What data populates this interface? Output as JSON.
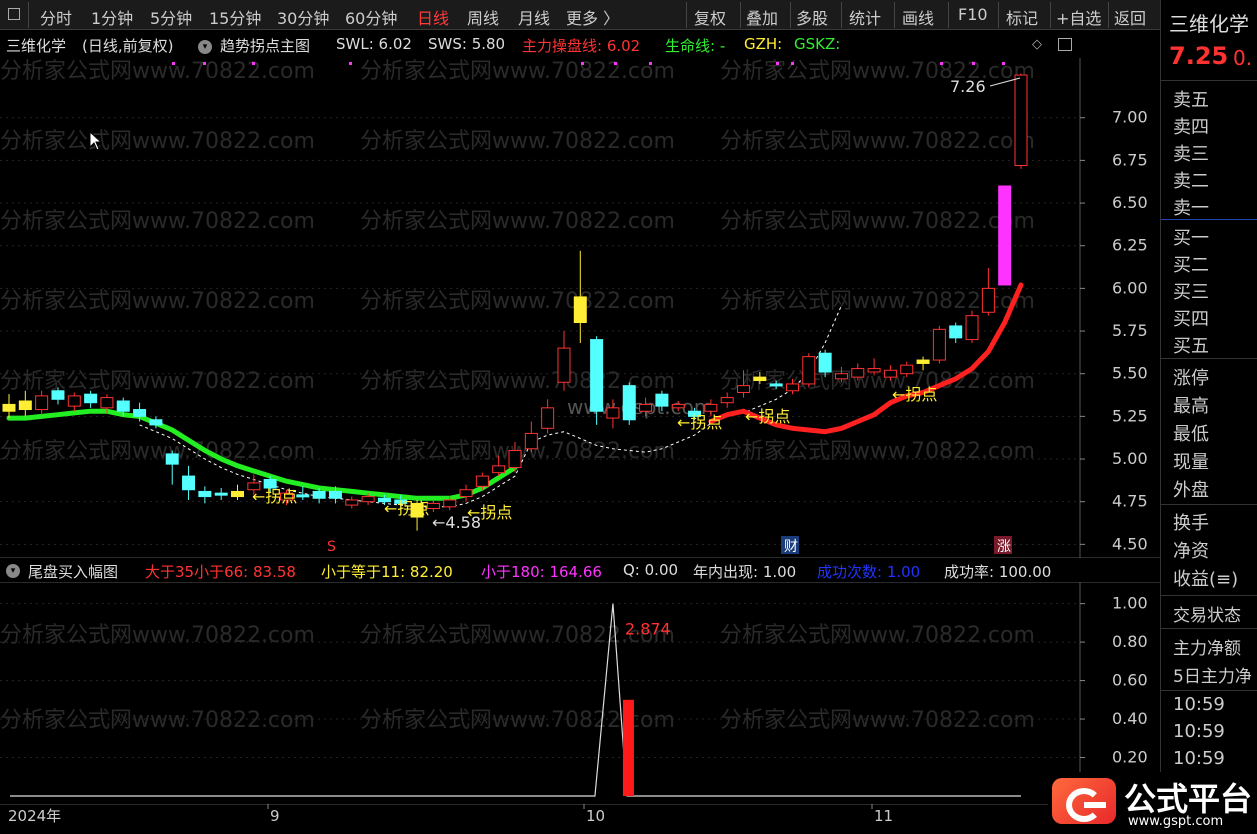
{
  "toolbar": {
    "tabs": [
      "分时",
      "1分钟",
      "5分钟",
      "15分钟",
      "30分钟",
      "60分钟",
      "日线",
      "周线",
      "月线",
      "更多 〉"
    ],
    "active_tab": "日线",
    "actions": [
      "复权",
      "叠加",
      "多股",
      "统计",
      "画线",
      "F10",
      "标记",
      "+自选",
      "返回"
    ]
  },
  "main_chart": {
    "stock_name": "三维化学",
    "period_label": "(日线,前复权)",
    "indicator_name": "趋势拐点主图",
    "swl": "SWL: 6.02",
    "sws": "SWS: 5.80",
    "main_control": "主力操盘线: 6.02",
    "life_line": "生命线: -",
    "gzh": "GZH:",
    "gskz": "GSKZ:",
    "high_label": "7.26",
    "low_label": "4.58",
    "turn_point_label": "←拐点",
    "watermark_url": "www.gspt.com",
    "watermark": "分析家公式网www.70822.com",
    "event_s": "S",
    "event_cai": "财",
    "event_zhang": "涨"
  },
  "sub_chart": {
    "indicator_name": "尾盘买入幅图",
    "gt35lt66": "大于35小于66: 83.58",
    "le11": "小于等于11: 82.20",
    "lt180": "小于180: 164.66",
    "q": "Q: 0.00",
    "year_count": "年内出现: 1.00",
    "success_count": "成功次数: 1.00",
    "success_rate": "成功率: 100.00",
    "peak_label": "2.874"
  },
  "x_axis": {
    "labels": [
      "2024年",
      "9",
      "10",
      "11"
    ]
  },
  "right_panel": {
    "stock_name": "三维化学",
    "price": "7.25",
    "price_suffix": "0.",
    "sell_levels": [
      "卖五",
      "卖四",
      "卖三",
      "卖二",
      "卖一"
    ],
    "buy_levels": [
      "买一",
      "买二",
      "买三",
      "买四",
      "买五"
    ],
    "stats": [
      "涨停",
      "最高",
      "最低",
      "现量",
      "外盘"
    ],
    "extra": [
      "换手",
      "净资",
      "收益(≡)"
    ],
    "trade_status": "交易状态",
    "main_net": "主力净额",
    "five_day": "5日主力净",
    "times": [
      "10:59",
      "10:59",
      "10:59"
    ]
  },
  "logo": {
    "text": "公式平台",
    "url": "www.gspt.com"
  },
  "colors": {
    "up": "#ff3232",
    "down": "#54ffff",
    "yellow": "#ffee33",
    "magenta": "#ff33ff",
    "red_line": "#ff2020",
    "green_line": "#22ee22"
  },
  "chart_data": [
    {
      "type": "candlestick",
      "title": "三维化学 (日线,前复权)",
      "y_ticks": [
        4.5,
        4.75,
        5.0,
        5.25,
        5.5,
        5.75,
        6.0,
        6.25,
        6.5,
        6.75,
        7.0
      ],
      "x_ticks": [
        "2024年",
        "9",
        "10",
        "11"
      ],
      "ylim": [
        4.42,
        7.35
      ],
      "candles": [
        {
          "o": 5.28,
          "c": 5.32,
          "h": 5.38,
          "l": 5.24,
          "t": "y"
        },
        {
          "o": 5.29,
          "c": 5.34,
          "h": 5.4,
          "l": 5.25,
          "t": "y"
        },
        {
          "o": 5.29,
          "c": 5.37,
          "h": 5.4,
          "l": 5.26,
          "t": "u"
        },
        {
          "o": 5.4,
          "c": 5.35,
          "h": 5.42,
          "l": 5.32,
          "t": "d"
        },
        {
          "o": 5.31,
          "c": 5.37,
          "h": 5.39,
          "l": 5.28,
          "t": "u"
        },
        {
          "o": 5.38,
          "c": 5.33,
          "h": 5.4,
          "l": 5.3,
          "t": "d"
        },
        {
          "o": 5.3,
          "c": 5.36,
          "h": 5.38,
          "l": 5.27,
          "t": "u"
        },
        {
          "o": 5.34,
          "c": 5.28,
          "h": 5.36,
          "l": 5.25,
          "t": "d"
        },
        {
          "o": 5.29,
          "c": 5.25,
          "h": 5.33,
          "l": 5.22,
          "t": "d"
        },
        {
          "o": 5.23,
          "c": 5.2,
          "h": 5.25,
          "l": 5.18,
          "t": "d"
        },
        {
          "o": 5.03,
          "c": 4.97,
          "h": 5.05,
          "l": 4.85,
          "t": "d"
        },
        {
          "o": 4.9,
          "c": 4.82,
          "h": 4.96,
          "l": 4.76,
          "t": "d"
        },
        {
          "o": 4.81,
          "c": 4.78,
          "h": 4.84,
          "l": 4.74,
          "t": "d"
        },
        {
          "o": 4.8,
          "c": 4.79,
          "h": 4.83,
          "l": 4.76,
          "t": "d"
        },
        {
          "o": 4.78,
          "c": 4.81,
          "h": 4.85,
          "l": 4.76,
          "t": "y"
        },
        {
          "o": 4.82,
          "c": 4.86,
          "h": 4.91,
          "l": 4.79,
          "t": "u"
        },
        {
          "o": 4.88,
          "c": 4.83,
          "h": 4.9,
          "l": 4.8,
          "t": "d"
        },
        {
          "o": 4.8,
          "c": 4.76,
          "h": 4.82,
          "l": 4.73,
          "t": "u"
        },
        {
          "o": 4.78,
          "c": 4.79,
          "h": 4.84,
          "l": 4.76,
          "t": "d"
        },
        {
          "o": 4.81,
          "c": 4.77,
          "h": 4.83,
          "l": 4.74,
          "t": "d"
        },
        {
          "o": 4.81,
          "c": 4.77,
          "h": 4.84,
          "l": 4.74,
          "t": "d"
        },
        {
          "o": 4.73,
          "c": 4.76,
          "h": 4.78,
          "l": 4.71,
          "t": "u"
        },
        {
          "o": 4.75,
          "c": 4.78,
          "h": 4.8,
          "l": 4.73,
          "t": "u"
        },
        {
          "o": 4.77,
          "c": 4.75,
          "h": 4.79,
          "l": 4.73,
          "t": "d"
        },
        {
          "o": 4.76,
          "c": 4.74,
          "h": 4.79,
          "l": 4.7,
          "t": "d"
        },
        {
          "o": 4.74,
          "c": 4.66,
          "h": 4.76,
          "l": 4.58,
          "t": "y"
        },
        {
          "o": 4.71,
          "c": 4.74,
          "h": 4.76,
          "l": 4.69,
          "t": "u"
        },
        {
          "o": 4.72,
          "c": 4.76,
          "h": 4.78,
          "l": 4.7,
          "t": "u"
        },
        {
          "o": 4.78,
          "c": 4.82,
          "h": 4.85,
          "l": 4.75,
          "t": "u"
        },
        {
          "o": 4.84,
          "c": 4.9,
          "h": 4.92,
          "l": 4.82,
          "t": "u"
        },
        {
          "o": 4.92,
          "c": 4.96,
          "h": 5.02,
          "l": 4.9,
          "t": "u"
        },
        {
          "o": 4.95,
          "c": 5.05,
          "h": 5.1,
          "l": 4.92,
          "t": "u"
        },
        {
          "o": 5.06,
          "c": 5.15,
          "h": 5.22,
          "l": 5.04,
          "t": "u"
        },
        {
          "o": 5.18,
          "c": 5.3,
          "h": 5.35,
          "l": 5.15,
          "t": "u"
        },
        {
          "o": 5.45,
          "c": 5.65,
          "h": 5.75,
          "l": 5.4,
          "t": "u"
        },
        {
          "o": 5.8,
          "c": 5.95,
          "h": 6.22,
          "l": 5.68,
          "t": "y"
        },
        {
          "o": 5.7,
          "c": 5.28,
          "h": 5.72,
          "l": 5.2,
          "t": "d"
        },
        {
          "o": 5.3,
          "c": 5.24,
          "h": 5.35,
          "l": 5.18,
          "t": "u"
        },
        {
          "o": 5.43,
          "c": 5.23,
          "h": 5.45,
          "l": 5.2,
          "t": "d"
        },
        {
          "o": 5.28,
          "c": 5.32,
          "h": 5.36,
          "l": 5.25,
          "t": "u"
        },
        {
          "o": 5.38,
          "c": 5.31,
          "h": 5.4,
          "l": 5.28,
          "t": "d"
        },
        {
          "o": 5.32,
          "c": 5.3,
          "h": 5.34,
          "l": 5.28,
          "t": "u"
        },
        {
          "o": 5.28,
          "c": 5.25,
          "h": 5.3,
          "l": 5.23,
          "t": "d"
        },
        {
          "o": 5.28,
          "c": 5.32,
          "h": 5.35,
          "l": 5.25,
          "t": "u"
        },
        {
          "o": 5.33,
          "c": 5.36,
          "h": 5.39,
          "l": 5.3,
          "t": "u"
        },
        {
          "o": 5.39,
          "c": 5.43,
          "h": 5.52,
          "l": 5.36,
          "t": "u"
        },
        {
          "o": 5.46,
          "c": 5.48,
          "h": 5.51,
          "l": 5.44,
          "t": "y"
        },
        {
          "o": 5.44,
          "c": 5.43,
          "h": 5.46,
          "l": 5.41,
          "t": "d"
        },
        {
          "o": 5.4,
          "c": 5.44,
          "h": 5.47,
          "l": 5.38,
          "t": "u"
        },
        {
          "o": 5.44,
          "c": 5.6,
          "h": 5.62,
          "l": 5.42,
          "t": "u"
        },
        {
          "o": 5.62,
          "c": 5.51,
          "h": 5.64,
          "l": 5.48,
          "t": "d"
        },
        {
          "o": 5.47,
          "c": 5.5,
          "h": 5.54,
          "l": 5.45,
          "t": "u"
        },
        {
          "o": 5.48,
          "c": 5.53,
          "h": 5.56,
          "l": 5.46,
          "t": "u"
        },
        {
          "o": 5.53,
          "c": 5.51,
          "h": 5.59,
          "l": 5.49,
          "t": "u"
        },
        {
          "o": 5.48,
          "c": 5.52,
          "h": 5.55,
          "l": 5.46,
          "t": "u"
        },
        {
          "o": 5.5,
          "c": 5.55,
          "h": 5.57,
          "l": 5.48,
          "t": "u"
        },
        {
          "o": 5.56,
          "c": 5.58,
          "h": 5.6,
          "l": 5.52,
          "t": "y"
        },
        {
          "o": 5.58,
          "c": 5.76,
          "h": 5.78,
          "l": 5.56,
          "t": "u"
        },
        {
          "o": 5.78,
          "c": 5.71,
          "h": 5.8,
          "l": 5.68,
          "t": "d"
        },
        {
          "o": 5.7,
          "c": 5.84,
          "h": 5.87,
          "l": 5.68,
          "t": "u"
        },
        {
          "o": 5.86,
          "c": 6.0,
          "h": 6.12,
          "l": 5.84,
          "t": "u"
        },
        {
          "o": 6.02,
          "c": 6.6,
          "h": 6.6,
          "l": 6.02,
          "t": "m"
        },
        {
          "o": 6.72,
          "c": 7.25,
          "h": 7.26,
          "l": 6.7,
          "t": "u"
        }
      ],
      "red_line": [
        5.22,
        5.26,
        5.28,
        5.24,
        5.2,
        5.18,
        5.17,
        5.16,
        5.18,
        5.22,
        5.26,
        5.33,
        5.37,
        5.39,
        5.43,
        5.47,
        5.53,
        5.63,
        5.8,
        6.02
      ],
      "green_line": [
        5.24,
        5.24,
        5.25,
        5.26,
        5.27,
        5.28,
        5.28,
        5.26,
        5.25,
        5.21,
        5.17,
        5.11,
        5.05,
        5.0,
        4.96,
        4.93,
        4.9,
        4.87,
        4.85,
        4.83,
        4.82,
        4.81,
        4.8,
        4.79,
        4.78,
        4.77,
        4.77,
        4.77,
        4.79,
        4.83,
        4.89,
        4.95
      ]
    },
    {
      "type": "line",
      "title": "尾盘买入幅图",
      "y_ticks": [
        0.2,
        0.4,
        0.6,
        0.8,
        1.0
      ],
      "ylim": [
        0,
        1.05
      ],
      "series": [
        {
          "values": [
            0,
            0,
            0,
            1.0,
            0.3,
            0,
            0
          ]
        }
      ],
      "bar_value": 0.5
    }
  ]
}
